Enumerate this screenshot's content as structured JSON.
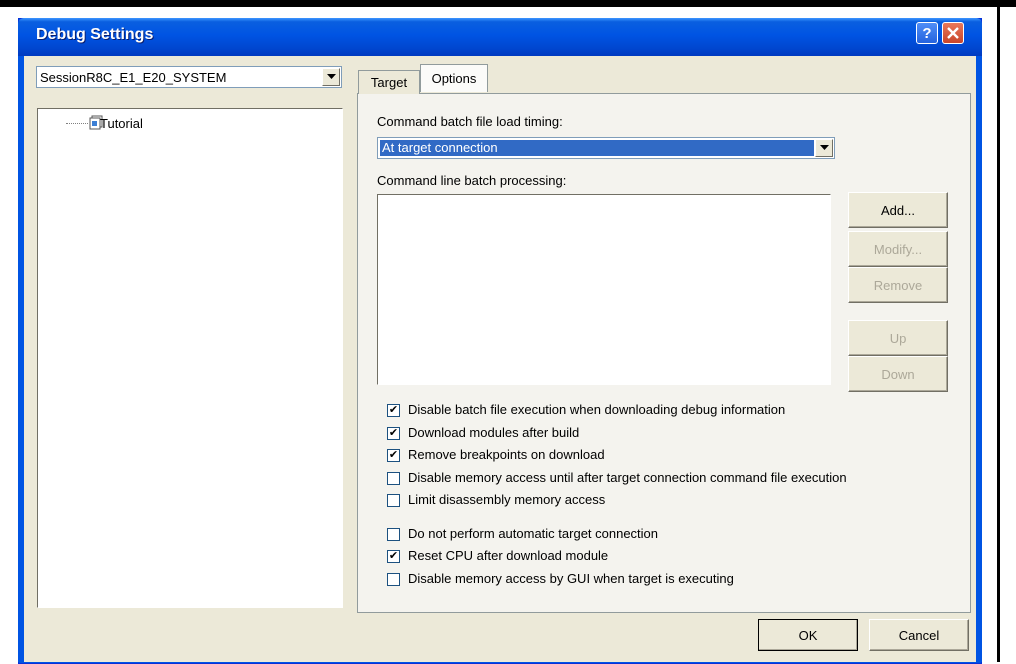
{
  "window": {
    "title": "Debug Settings",
    "help_symbol": "?",
    "close_symbol": "X"
  },
  "session": {
    "selected": "SessionR8C_E1_E20_SYSTEM"
  },
  "tree": {
    "items": [
      {
        "label": "Tutorial",
        "icon": "project-icon"
      }
    ]
  },
  "tabs": [
    {
      "label": "Target",
      "active": false
    },
    {
      "label": "Options",
      "active": true
    }
  ],
  "options": {
    "timing_label": "Command batch file load timing:",
    "timing_value": "At target connection",
    "batch_label": "Command line batch processing:",
    "buttons": {
      "add": "Add...",
      "modify": "Modify...",
      "remove": "Remove",
      "up": "Up",
      "down": "Down"
    },
    "checkboxes": [
      {
        "label": "Disable batch file execution when downloading debug information",
        "checked": true
      },
      {
        "label": "Download modules after build",
        "checked": true
      },
      {
        "label": "Remove breakpoints on download",
        "checked": true
      },
      {
        "label": "Disable memory access until after target connection command file execution",
        "checked": false
      },
      {
        "label": "Limit disassembly memory access",
        "checked": false
      },
      {
        "label": "Do not perform automatic target connection",
        "checked": false
      },
      {
        "label": "Reset CPU after download module",
        "checked": true
      },
      {
        "label": "Disable memory access by GUI when target is executing",
        "checked": false
      }
    ]
  },
  "footer": {
    "ok": "OK",
    "cancel": "Cancel"
  },
  "colors": {
    "titlebar": "#0054e3",
    "dialog_bg": "#ece9d8",
    "selection": "#316ac5"
  }
}
